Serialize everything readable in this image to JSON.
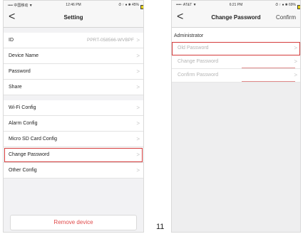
{
  "left_screen": {
    "status": {
      "carrier": "•••• 中国移动 ▼",
      "time": "12:46 PM",
      "right": "⏱ ↑ ● ✱ 45%"
    },
    "nav": {
      "back": "<",
      "title": "Setting"
    },
    "rows": [
      {
        "label": "ID",
        "value": "PPRT-058566-WVBPF"
      },
      {
        "label": "Device Name",
        "value": ""
      },
      {
        "label": "Password",
        "value": ""
      },
      {
        "label": "Share",
        "value": ""
      },
      {
        "label": "Wi-Fi Config",
        "value": ""
      },
      {
        "label": "Alarm Config",
        "value": ""
      },
      {
        "label": "Micro SD Card Config",
        "value": ""
      },
      {
        "label": "Change Password",
        "value": ""
      },
      {
        "label": "Other Config",
        "value": ""
      }
    ],
    "chevron": ">",
    "remove_button": "Remove device"
  },
  "right_screen": {
    "status": {
      "carrier": "••••◦ AT&T ▼",
      "time": "6:21 PM",
      "right": "⏱ ↑ ● ✱ 69%"
    },
    "nav": {
      "back": "<",
      "title": "Change Password",
      "action": "Confirm"
    },
    "section_label": "Administrator",
    "fields": {
      "old": "Old Password",
      "new": "Change Password",
      "confirm": "Confirm Password"
    },
    "chevron": ">"
  },
  "page_number": "11",
  "colors": {
    "highlight": "#d43b3b",
    "remove": "#e04b4b",
    "battery": "#e6d21a"
  }
}
